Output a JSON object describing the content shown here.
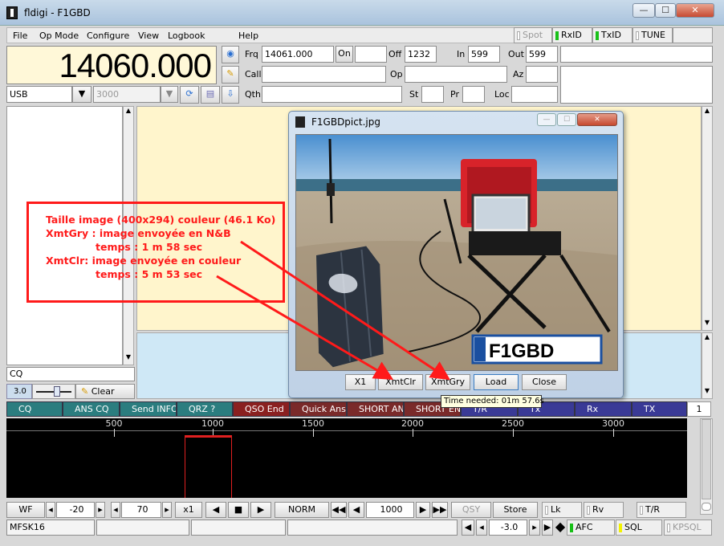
{
  "window": {
    "title": "fldigi - F1GBD",
    "btn_min": "—",
    "btn_max": "☐",
    "btn_close": "✕"
  },
  "menu": {
    "file": "File",
    "opmode": "Op Mode",
    "configure": "Configure",
    "view": "View",
    "logbook": "Logbook",
    "help": "Help"
  },
  "toggles": {
    "spot": "Spot",
    "rxid": "RxID",
    "txid": "TxID",
    "tune": "TUNE"
  },
  "freq": {
    "display": "14060.000",
    "mode": "USB",
    "bandwidth": "3000"
  },
  "log": {
    "frq_label": "Frq",
    "frq_value": "14061.000",
    "on_label": "On",
    "on_value": "",
    "off_label": "Off",
    "off_value": "1232",
    "in_label": "In",
    "in_value": "599",
    "out_label": "Out",
    "out_value": "599",
    "call_label": "Call",
    "call_value": "",
    "op_label": "Op",
    "op_value": "",
    "az_label": "Az",
    "az_value": "",
    "qth_label": "Qth",
    "qth_value": "",
    "st_label": "St",
    "st_value": "",
    "pr_label": "Pr",
    "pr_value": "",
    "loc_label": "Loc",
    "loc_value": ""
  },
  "left": {
    "cq_text": "CQ",
    "squelch_value": "3.0",
    "clear_label": "Clear"
  },
  "dialog": {
    "title": "F1GBDpict.jpg",
    "btn_x1": "X1",
    "btn_xmtclr": "XmtClr",
    "btn_xmtgry": "XmtGry",
    "btn_load": "Load",
    "btn_close": "Close",
    "tooltip": "Time needed:  01m 57.6s",
    "plate": "F1GBD"
  },
  "annotation": {
    "line1": "Taille image (400x294) couleur (46.1 Ko)",
    "line2": "XmtGry : image envoyée en N&B",
    "line3": "temps : 1 m 58 sec",
    "line4": "XmtClr: image envoyée en couleur",
    "line5": "temps : 5 m 53 sec",
    "color": "#ff1a1a"
  },
  "macros": [
    {
      "label": "CQ",
      "color": "#2b7d7f"
    },
    {
      "label": "ANS CQ",
      "color": "#2b7d7f"
    },
    {
      "label": "Send INFO",
      "color": "#2b7d7f"
    },
    {
      "label": "QRZ ?",
      "color": "#2b7d7f"
    },
    {
      "label": "QSO End",
      "color": "#8a2020"
    },
    {
      "label": "Quick Ans",
      "color": "#7a2a2a"
    },
    {
      "label": "SHORT ANS",
      "color": "#7a2a2a"
    },
    {
      "label": "SHORT END",
      "color": "#7a2a2a"
    },
    {
      "label": "T/R",
      "color": "#3a3a96"
    },
    {
      "label": "Tx",
      "color": "#3a3a96"
    },
    {
      "label": "Rx",
      "color": "#3a3a96"
    },
    {
      "label": "TX",
      "color": "#3a3a96"
    }
  ],
  "macro_page": "1",
  "scale": {
    "ticks": [
      "500",
      "1000",
      "1500",
      "2000",
      "2500",
      "3000"
    ]
  },
  "wf": {
    "wf_label": "WF",
    "ref_value": "-20",
    "range_value": "70",
    "zoom_label": "x1",
    "norm_label": "NORM",
    "carrier_value": "1000",
    "qsy_label": "QSY",
    "store_label": "Store",
    "lk_label": "Lk",
    "rv_label": "Rv",
    "tr_label": "T/R"
  },
  "status": {
    "mode": "MFSK16",
    "sn_value": "-3.0",
    "afc_label": "AFC",
    "sql_label": "SQL",
    "kpsql_label": "KPSQL"
  }
}
